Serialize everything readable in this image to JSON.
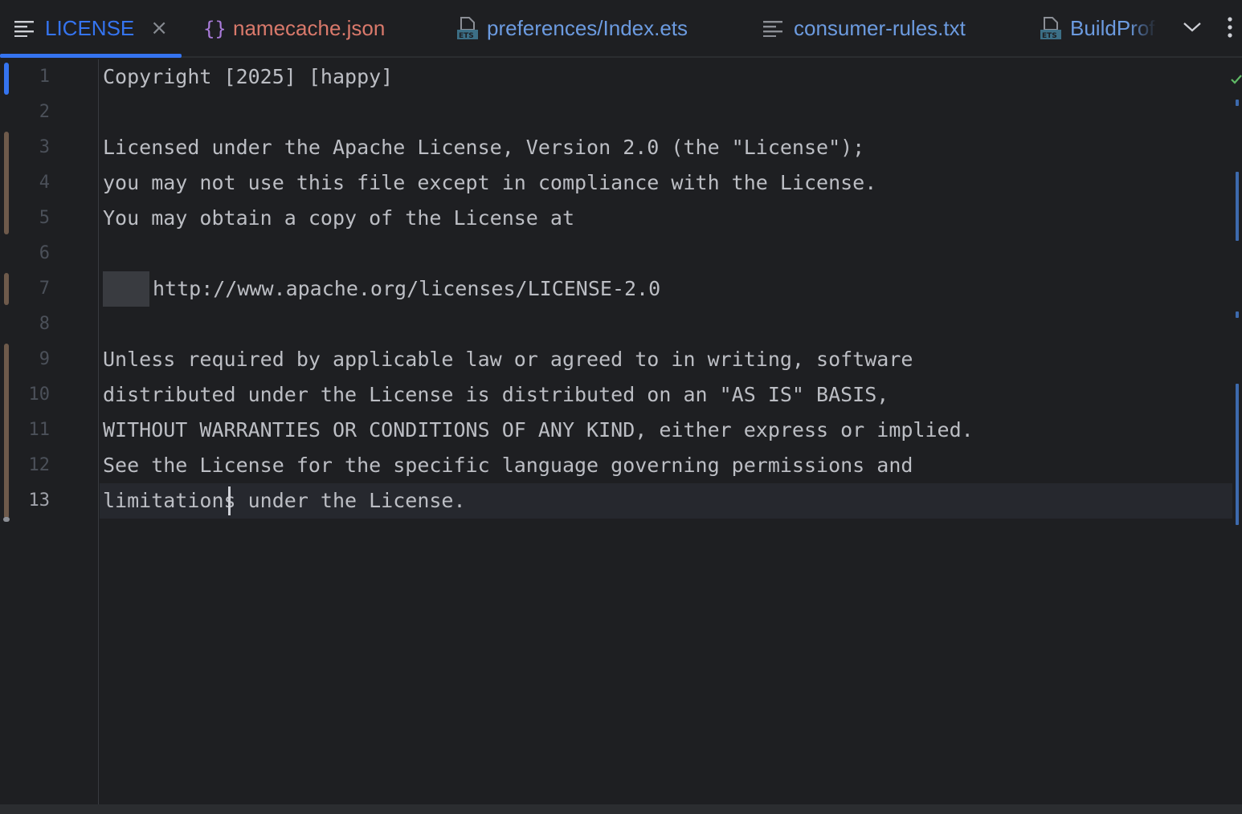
{
  "tabs": [
    {
      "label": "LICENSE",
      "icon": "text-lines-icon",
      "color": "#3574f0",
      "active": true,
      "close": "×"
    },
    {
      "label": "namecache.json",
      "icon": "json-braces-icon",
      "color": "#d9796b",
      "active": false
    },
    {
      "label": "preferences/Index.ets",
      "icon": "ets-file-icon",
      "color": "#6c9be0",
      "active": false
    },
    {
      "label": "consumer-rules.txt",
      "icon": "text-lines-icon",
      "color": "#6c9be0",
      "active": false
    },
    {
      "label": "BuildProf",
      "icon": "ets-file-icon",
      "color": "#6c9be0",
      "active": false
    }
  ],
  "editor": {
    "current_line": 13,
    "lines": [
      {
        "no": "1",
        "text": "Copyright [2025] [happy]"
      },
      {
        "no": "2",
        "text": ""
      },
      {
        "no": "3",
        "text": "Licensed under the Apache License, Version 2.0 (the \"License\");"
      },
      {
        "no": "4",
        "text": "you may not use this file except in compliance with the License."
      },
      {
        "no": "5",
        "text": "You may obtain a copy of the License at"
      },
      {
        "no": "6",
        "text": ""
      },
      {
        "no": "7",
        "text": "http://www.apache.org/licenses/LICENSE-2.0"
      },
      {
        "no": "8",
        "text": ""
      },
      {
        "no": "9",
        "text": "Unless required by applicable law or agreed to in writing, software"
      },
      {
        "no": "10",
        "text": "distributed under the License is distributed on an \"AS IS\" BASIS,"
      },
      {
        "no": "11",
        "text": "WITHOUT WARRANTIES OR CONDITIONS OF ANY KIND, either express or implied."
      },
      {
        "no": "12",
        "text": "See the License for the specific language governing permissions and"
      },
      {
        "no": "13",
        "text": "limitations under the License."
      }
    ]
  },
  "colors": {
    "background": "#1e1f22",
    "accent": "#3574f0",
    "text": "#bcbec4",
    "line_number": "#4b5059",
    "vcs_modified": "#6e5a4b",
    "vcs_added": "#3574f0"
  }
}
